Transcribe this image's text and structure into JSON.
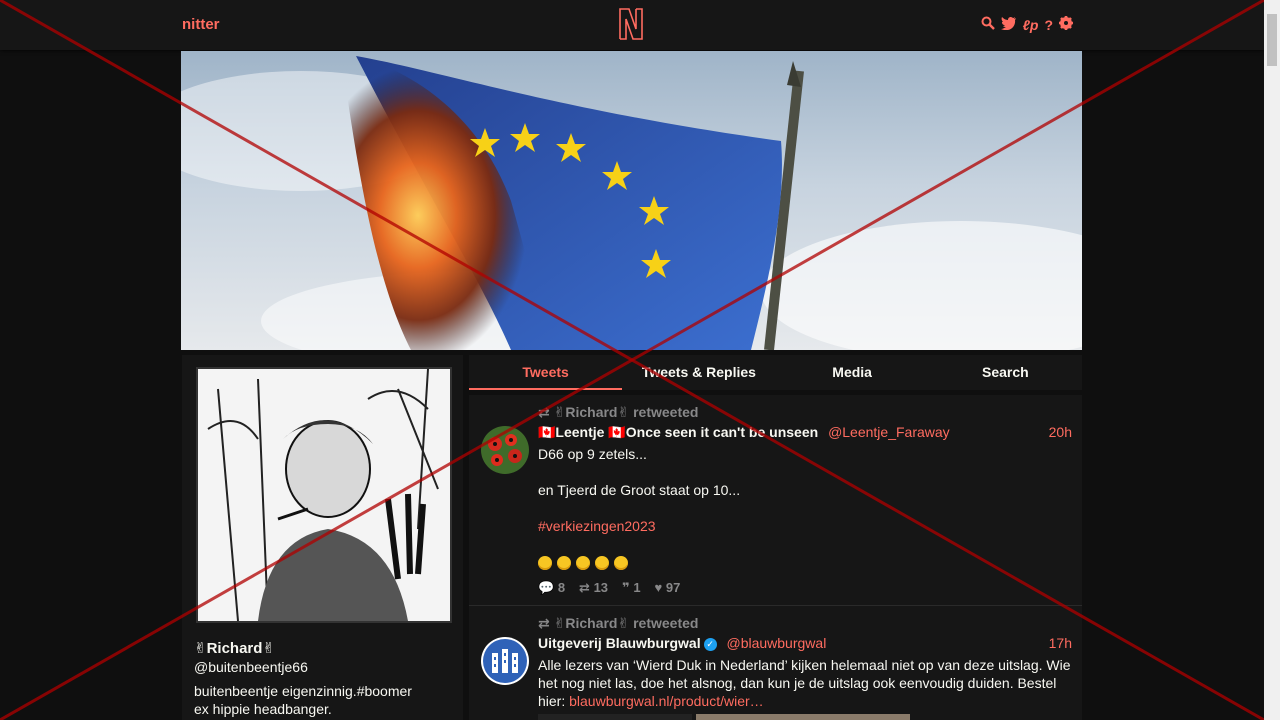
{
  "nav": {
    "brand": "nitter",
    "logo_letter": "N",
    "icons": [
      "search-icon",
      "twitter-icon",
      "liberapay-icon",
      "help-icon",
      "settings-icon"
    ]
  },
  "colors": {
    "accent": "#ff6c60",
    "bg": "#0f0f0f",
    "panel": "#161616",
    "muted": "#888889",
    "overlay_red": "#b00000"
  },
  "profile": {
    "name": "✌Richard✌",
    "handle": "@buitenbeentje66",
    "bio": "buitenbeentje eigenzinnig.#boomer\nex hippie headbanger."
  },
  "tabs": [
    "Tweets",
    "Tweets & Replies",
    "Media",
    "Search"
  ],
  "tweets": [
    {
      "retweet_label": "✌Richard✌ retweeted",
      "fullname": "🇨🇦Leentje 🇨🇦Once seen it can't be unseen",
      "username": "@Leentje_Faraway",
      "date": "20h",
      "lines": [
        "D66 op 9 zetels...",
        "en Tjeerd de Groot staat op 10...",
        "#verkiezingen2023"
      ],
      "stats": {
        "replies": "8",
        "retweets": "13",
        "quotes": "1",
        "likes": "97"
      }
    },
    {
      "retweet_label": "✌Richard✌ retweeted",
      "fullname": "Uitgeverij Blauwburgwal",
      "username": "@blauwburgwal",
      "date": "17h",
      "text": "Alle lezers van ‘Wierd Duk in Nederland’ kijken helemaal niet op van deze uitslag. Wie het nog niet las, doe het alsnog, dan kun je de uitslag ook eenvoudig duiden. Bestel hier: ",
      "link": "blauwburgwal.nl/product/wier…"
    }
  ]
}
